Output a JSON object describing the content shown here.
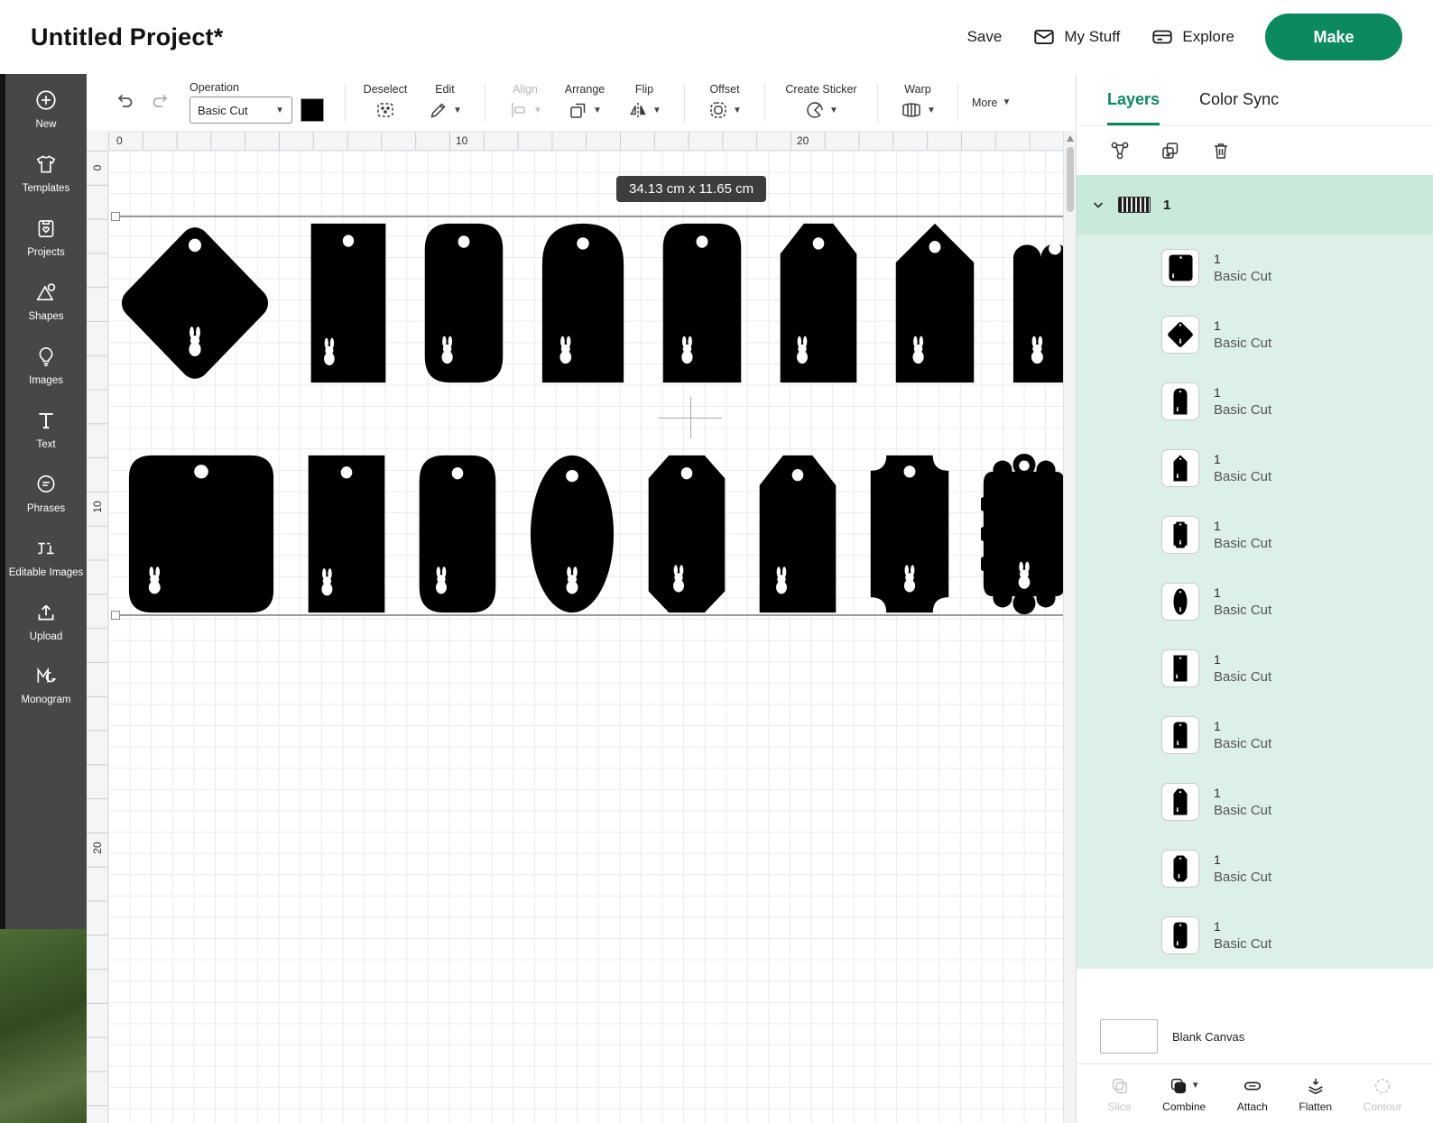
{
  "header": {
    "title": "Untitled Project*",
    "save_label": "Save",
    "my_stuff_label": "My Stuff",
    "explore_label": "Explore",
    "make_label": "Make"
  },
  "sidebar": {
    "items": [
      {
        "id": "new",
        "label": "New"
      },
      {
        "id": "templates",
        "label": "Templates"
      },
      {
        "id": "projects",
        "label": "Projects"
      },
      {
        "id": "shapes",
        "label": "Shapes"
      },
      {
        "id": "images",
        "label": "Images"
      },
      {
        "id": "text",
        "label": "Text"
      },
      {
        "id": "phrases",
        "label": "Phrases"
      },
      {
        "id": "editable-images",
        "label": "Editable Images"
      },
      {
        "id": "upload",
        "label": "Upload"
      },
      {
        "id": "monogram",
        "label": "Monogram"
      }
    ]
  },
  "toolbar": {
    "operation_label": "Operation",
    "operation_value": "Basic Cut",
    "deselect_label": "Deselect",
    "edit_label": "Edit",
    "align_label": "Align",
    "arrange_label": "Arrange",
    "flip_label": "Flip",
    "offset_label": "Offset",
    "create_sticker_label": "Create Sticker",
    "warp_label": "Warp",
    "more_label": "More"
  },
  "rulers": {
    "horizontal": [
      "0",
      "10",
      "20"
    ],
    "vertical": [
      "0",
      "10",
      "20"
    ]
  },
  "canvas": {
    "selection_tooltip": "34.13 cm x 11.65 cm",
    "rows": [
      {
        "shapes": [
          "diamond",
          "rect",
          "rounded-rect",
          "dome-tag",
          "dome-tag2",
          "chamfer-tag",
          "point-tag",
          "scallop-tag"
        ]
      },
      {
        "shapes": [
          "rounded-square",
          "rect",
          "rounded-rect",
          "ellipse",
          "hex-tag",
          "chamfer-tag",
          "bracket-tag",
          "ornate-tag"
        ]
      }
    ]
  },
  "layers_panel": {
    "tabs": [
      {
        "label": "Layers",
        "active": true
      },
      {
        "label": "Color Sync",
        "active": false
      }
    ],
    "group_label": "1",
    "layers": [
      {
        "title": "1",
        "subtitle": "Basic Cut",
        "shape": "rounded-square"
      },
      {
        "title": "1",
        "subtitle": "Basic Cut",
        "shape": "diamond"
      },
      {
        "title": "1",
        "subtitle": "Basic Cut",
        "shape": "dome-tag"
      },
      {
        "title": "1",
        "subtitle": "Basic Cut",
        "shape": "point-tag"
      },
      {
        "title": "1",
        "subtitle": "Basic Cut",
        "shape": "bracket-tag"
      },
      {
        "title": "1",
        "subtitle": "Basic Cut",
        "shape": "ellipse"
      },
      {
        "title": "1",
        "subtitle": "Basic Cut",
        "shape": "rect"
      },
      {
        "title": "1",
        "subtitle": "Basic Cut",
        "shape": "dome-tag2"
      },
      {
        "title": "1",
        "subtitle": "Basic Cut",
        "shape": "chamfer-tag"
      },
      {
        "title": "1",
        "subtitle": "Basic Cut",
        "shape": "hex-tag"
      },
      {
        "title": "1",
        "subtitle": "Basic Cut",
        "shape": "rounded-rect"
      }
    ],
    "blank_canvas_label": "Blank Canvas",
    "actions": [
      {
        "label": "Slice",
        "enabled": false
      },
      {
        "label": "Combine",
        "enabled": true,
        "caret": true
      },
      {
        "label": "Attach",
        "enabled": true
      },
      {
        "label": "Flatten",
        "enabled": true
      },
      {
        "label": "Contour",
        "enabled": false
      }
    ]
  },
  "colors": {
    "accent_green": "#0b8a5e",
    "mint": "#dcf0e7",
    "shape_fill": "#000000"
  }
}
